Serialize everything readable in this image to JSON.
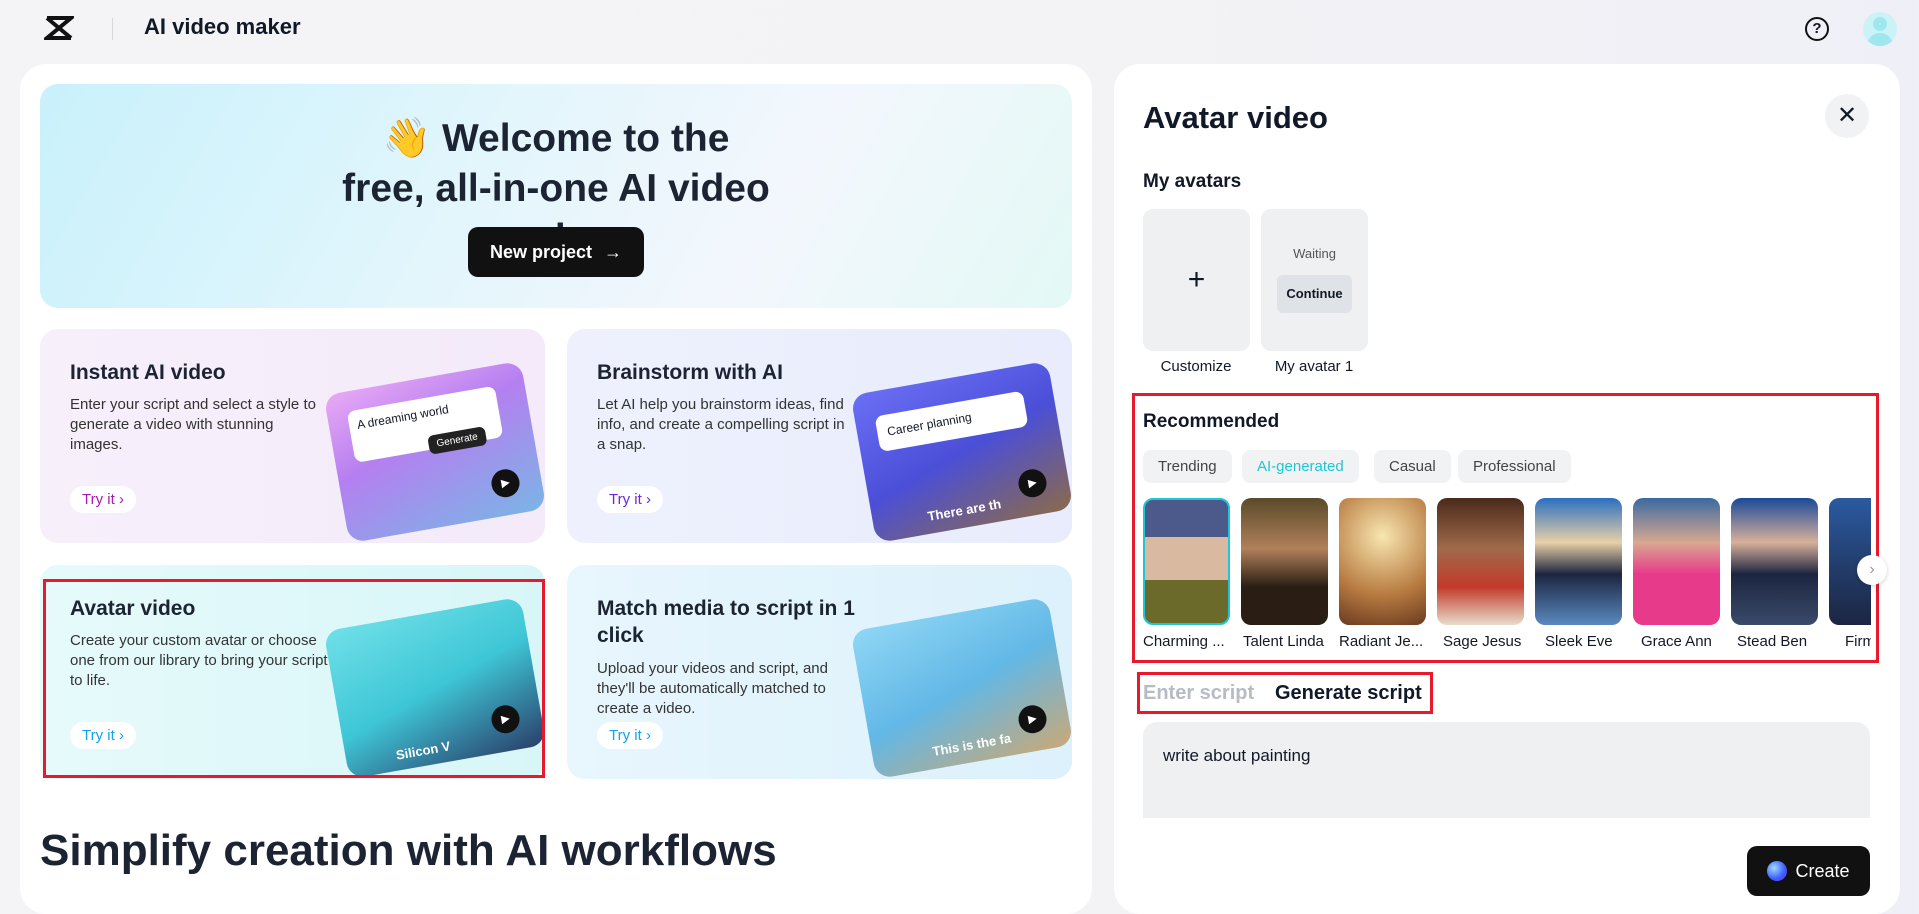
{
  "header": {
    "title": "AI video maker",
    "help_icon": "?"
  },
  "banner": {
    "emoji": "👋",
    "title": "Welcome to the free, all-in-one AI video maker",
    "button": "New project"
  },
  "cards": [
    {
      "title": "Instant AI video",
      "desc": "Enter your script and select a style to generate a video with stunning images.",
      "cta": "Try it",
      "thumb_text": "A dreaming world",
      "thumb_btn": "Generate",
      "color": "#a21caf"
    },
    {
      "title": "Brainstorm with AI",
      "desc": "Let AI help you brainstorm ideas, find info, and create a compelling script in a snap.",
      "cta": "Try it",
      "thumb_text": "Career planning",
      "thumb_caption": "There are th",
      "color": "#6d28d9"
    },
    {
      "title": "Avatar video",
      "desc": "Create your custom avatar or choose one from our library to bring your script to life.",
      "cta": "Try it",
      "thumb_caption": "Silicon V",
      "color": "#0ea5e9"
    },
    {
      "title": "Match media to script in 1 click",
      "desc": "Upload your videos and script, and they'll be automatically matched to create a video.",
      "cta": "Try it",
      "thumb_caption": "This is the fa",
      "color": "#0ea5e9"
    }
  ],
  "section_heading": "Simplify creation with AI workflows",
  "right": {
    "title": "Avatar video",
    "my_avatars": "My avatars",
    "customize": "Customize",
    "my_avatar_1": {
      "status": "Waiting",
      "button": "Continue",
      "label": "My avatar 1"
    },
    "recommended": "Recommended",
    "chips": [
      "Trending",
      "AI-generated",
      "Casual",
      "Professional"
    ],
    "avatars": [
      "Charming ...",
      "Talent Linda",
      "Radiant Je...",
      "Sage Jesus",
      "Sleek Eve",
      "Grace Ann",
      "Stead Ben",
      "Firm"
    ],
    "tabs": [
      "Enter script",
      "Generate script"
    ],
    "script_value": "write about painting",
    "create": "Create"
  },
  "colors": {
    "accent": "#1fc7d6",
    "highlight": "#e8192c"
  }
}
